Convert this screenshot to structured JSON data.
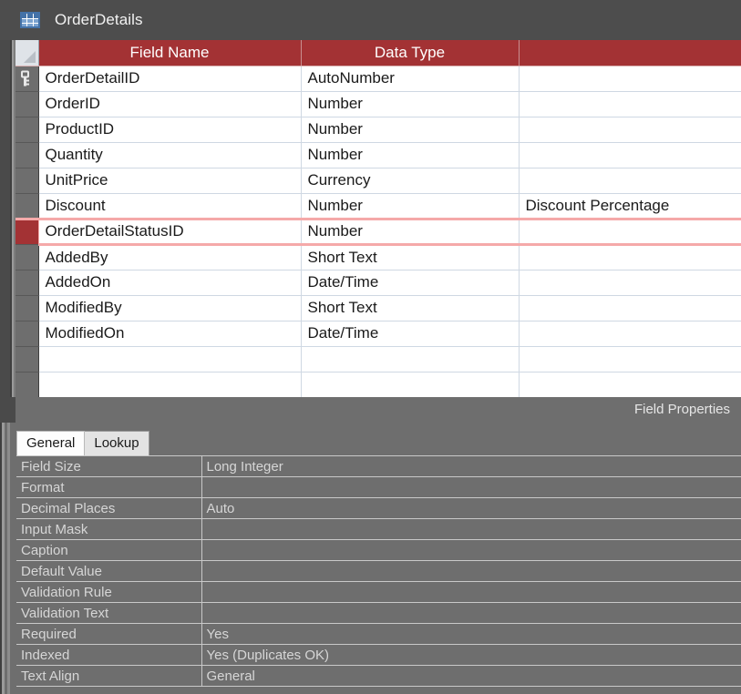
{
  "window": {
    "title": "OrderDetails",
    "icon": "table-icon"
  },
  "design_grid": {
    "columns": [
      "Field Name",
      "Data Type",
      ""
    ],
    "rows": [
      {
        "field_name": "OrderDetailID",
        "data_type": "AutoNumber",
        "description": "",
        "primary_key": true,
        "active": false
      },
      {
        "field_name": "OrderID",
        "data_type": "Number",
        "description": "",
        "primary_key": false,
        "active": false
      },
      {
        "field_name": "ProductID",
        "data_type": "Number",
        "description": "",
        "primary_key": false,
        "active": false
      },
      {
        "field_name": "Quantity",
        "data_type": "Number",
        "description": "",
        "primary_key": false,
        "active": false
      },
      {
        "field_name": "UnitPrice",
        "data_type": "Currency",
        "description": "",
        "primary_key": false,
        "active": false
      },
      {
        "field_name": "Discount",
        "data_type": "Number",
        "description": "Discount Percentage",
        "primary_key": false,
        "active": false
      },
      {
        "field_name": "OrderDetailStatusID",
        "data_type": "Number",
        "description": "",
        "primary_key": false,
        "active": true
      },
      {
        "field_name": "AddedBy",
        "data_type": "Short Text",
        "description": "",
        "primary_key": false,
        "active": false
      },
      {
        "field_name": "AddedOn",
        "data_type": "Date/Time",
        "description": "",
        "primary_key": false,
        "active": false
      },
      {
        "field_name": "ModifiedBy",
        "data_type": "Short Text",
        "description": "",
        "primary_key": false,
        "active": false
      },
      {
        "field_name": "ModifiedOn",
        "data_type": "Date/Time",
        "description": "",
        "primary_key": false,
        "active": false
      },
      {
        "field_name": "",
        "data_type": "",
        "description": "",
        "primary_key": false,
        "active": false
      },
      {
        "field_name": "",
        "data_type": "",
        "description": "",
        "primary_key": false,
        "active": false
      }
    ]
  },
  "field_properties": {
    "heading": "Field Properties",
    "tabs": [
      {
        "label": "General",
        "active": true
      },
      {
        "label": "Lookup",
        "active": false
      }
    ],
    "rows": [
      {
        "label": "Field Size",
        "value": "Long Integer"
      },
      {
        "label": "Format",
        "value": ""
      },
      {
        "label": "Decimal Places",
        "value": "Auto"
      },
      {
        "label": "Input Mask",
        "value": ""
      },
      {
        "label": "Caption",
        "value": ""
      },
      {
        "label": "Default Value",
        "value": ""
      },
      {
        "label": "Validation Rule",
        "value": ""
      },
      {
        "label": "Validation Text",
        "value": ""
      },
      {
        "label": "Required",
        "value": "Yes"
      },
      {
        "label": "Indexed",
        "value": "Yes (Duplicates OK)"
      },
      {
        "label": "Text Align",
        "value": "General"
      }
    ]
  },
  "colors": {
    "header_red": "#a33234",
    "selection_pink": "#f5a9a9",
    "pane_gray": "#6e6e6e",
    "chrome_gray": "#4d4d4d"
  }
}
